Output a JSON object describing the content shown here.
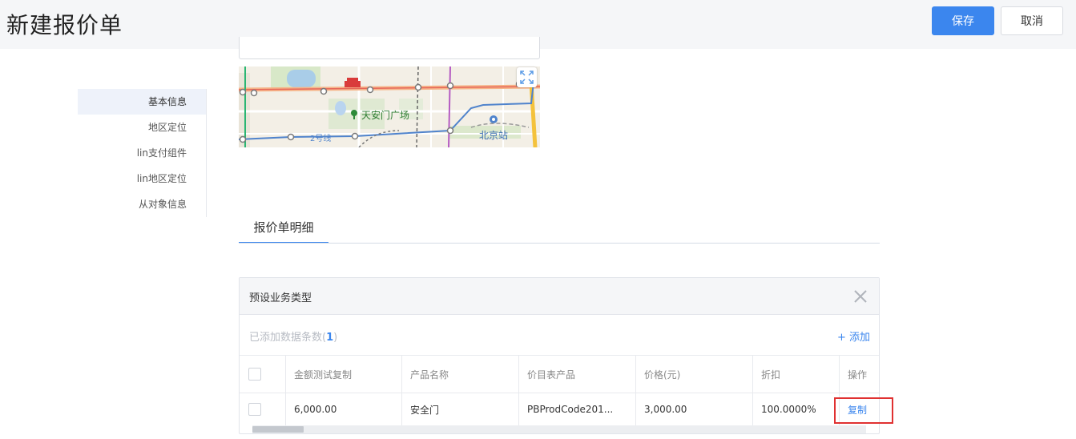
{
  "header": {
    "title": "新建报价单",
    "save_label": "保存",
    "cancel_label": "取消"
  },
  "nav": {
    "items": [
      {
        "label": "基本信息",
        "active": true
      },
      {
        "label": "地区定位",
        "active": false
      },
      {
        "label": "lin支付组件",
        "active": false
      },
      {
        "label": "lin地区定位",
        "active": false
      },
      {
        "label": "从对象信息",
        "active": false
      }
    ]
  },
  "map": {
    "label_square": "天安门广场",
    "label_station": "北京站",
    "label_line": "2号线"
  },
  "tabs": [
    {
      "label": "报价单明细",
      "active": true
    }
  ],
  "detail": {
    "title": "预设业务类型",
    "count_prefix": "已添加数据条数(",
    "count": "1",
    "count_suffix": ")",
    "add_label": "+ 添加",
    "columns": [
      "金额测试复制",
      "产品名称",
      "价目表产品",
      "价格(元)",
      "折扣",
      "操作"
    ],
    "rows": [
      {
        "amount": "6,000.00",
        "product": "安全门",
        "pricebook_product": "PBProdCode201...",
        "price": "3,000.00",
        "discount": "100.0000%",
        "action": "复制"
      }
    ]
  },
  "colors": {
    "primary": "#3b86ee",
    "highlight": "#e03131",
    "header_bg": "#f5f6f8"
  },
  "icons": {
    "close": "close-icon",
    "expand": "expand-icon",
    "checkbox": "checkbox"
  }
}
